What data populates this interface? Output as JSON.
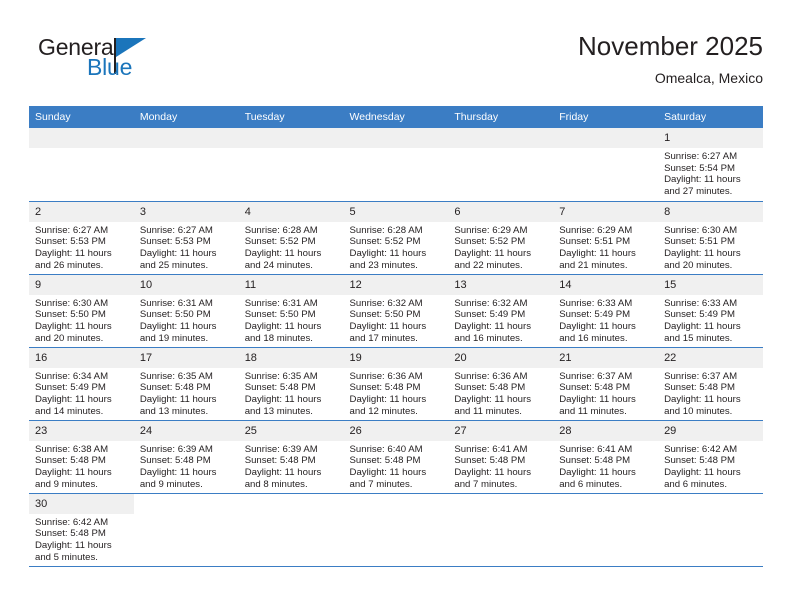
{
  "logo": {
    "name": "general-blue-logo",
    "word_one": "General",
    "word_two": "Blue",
    "brand_color": "#1b75bb"
  },
  "header": {
    "title": "November 2025",
    "subtitle": "Omealca, Mexico"
  },
  "theme": {
    "header_blue": "#3b7dc4",
    "daynum_band": "#f0f0f0",
    "text": "#231f20"
  },
  "calendar": {
    "weekday_headers": [
      "Sunday",
      "Monday",
      "Tuesday",
      "Wednesday",
      "Thursday",
      "Friday",
      "Saturday"
    ],
    "weeks": [
      [
        {
          "day": "",
          "empty": true
        },
        {
          "day": "",
          "empty": true
        },
        {
          "day": "",
          "empty": true
        },
        {
          "day": "",
          "empty": true
        },
        {
          "day": "",
          "empty": true
        },
        {
          "day": "",
          "empty": true
        },
        {
          "day": "1",
          "sunrise": "Sunrise: 6:27 AM",
          "sunset": "Sunset: 5:54 PM",
          "daylight_1": "Daylight: 11 hours",
          "daylight_2": "and 27 minutes."
        }
      ],
      [
        {
          "day": "2",
          "sunrise": "Sunrise: 6:27 AM",
          "sunset": "Sunset: 5:53 PM",
          "daylight_1": "Daylight: 11 hours",
          "daylight_2": "and 26 minutes."
        },
        {
          "day": "3",
          "sunrise": "Sunrise: 6:27 AM",
          "sunset": "Sunset: 5:53 PM",
          "daylight_1": "Daylight: 11 hours",
          "daylight_2": "and 25 minutes."
        },
        {
          "day": "4",
          "sunrise": "Sunrise: 6:28 AM",
          "sunset": "Sunset: 5:52 PM",
          "daylight_1": "Daylight: 11 hours",
          "daylight_2": "and 24 minutes."
        },
        {
          "day": "5",
          "sunrise": "Sunrise: 6:28 AM",
          "sunset": "Sunset: 5:52 PM",
          "daylight_1": "Daylight: 11 hours",
          "daylight_2": "and 23 minutes."
        },
        {
          "day": "6",
          "sunrise": "Sunrise: 6:29 AM",
          "sunset": "Sunset: 5:52 PM",
          "daylight_1": "Daylight: 11 hours",
          "daylight_2": "and 22 minutes."
        },
        {
          "day": "7",
          "sunrise": "Sunrise: 6:29 AM",
          "sunset": "Sunset: 5:51 PM",
          "daylight_1": "Daylight: 11 hours",
          "daylight_2": "and 21 minutes."
        },
        {
          "day": "8",
          "sunrise": "Sunrise: 6:30 AM",
          "sunset": "Sunset: 5:51 PM",
          "daylight_1": "Daylight: 11 hours",
          "daylight_2": "and 20 minutes."
        }
      ],
      [
        {
          "day": "9",
          "sunrise": "Sunrise: 6:30 AM",
          "sunset": "Sunset: 5:50 PM",
          "daylight_1": "Daylight: 11 hours",
          "daylight_2": "and 20 minutes."
        },
        {
          "day": "10",
          "sunrise": "Sunrise: 6:31 AM",
          "sunset": "Sunset: 5:50 PM",
          "daylight_1": "Daylight: 11 hours",
          "daylight_2": "and 19 minutes."
        },
        {
          "day": "11",
          "sunrise": "Sunrise: 6:31 AM",
          "sunset": "Sunset: 5:50 PM",
          "daylight_1": "Daylight: 11 hours",
          "daylight_2": "and 18 minutes."
        },
        {
          "day": "12",
          "sunrise": "Sunrise: 6:32 AM",
          "sunset": "Sunset: 5:50 PM",
          "daylight_1": "Daylight: 11 hours",
          "daylight_2": "and 17 minutes."
        },
        {
          "day": "13",
          "sunrise": "Sunrise: 6:32 AM",
          "sunset": "Sunset: 5:49 PM",
          "daylight_1": "Daylight: 11 hours",
          "daylight_2": "and 16 minutes."
        },
        {
          "day": "14",
          "sunrise": "Sunrise: 6:33 AM",
          "sunset": "Sunset: 5:49 PM",
          "daylight_1": "Daylight: 11 hours",
          "daylight_2": "and 16 minutes."
        },
        {
          "day": "15",
          "sunrise": "Sunrise: 6:33 AM",
          "sunset": "Sunset: 5:49 PM",
          "daylight_1": "Daylight: 11 hours",
          "daylight_2": "and 15 minutes."
        }
      ],
      [
        {
          "day": "16",
          "sunrise": "Sunrise: 6:34 AM",
          "sunset": "Sunset: 5:49 PM",
          "daylight_1": "Daylight: 11 hours",
          "daylight_2": "and 14 minutes."
        },
        {
          "day": "17",
          "sunrise": "Sunrise: 6:35 AM",
          "sunset": "Sunset: 5:48 PM",
          "daylight_1": "Daylight: 11 hours",
          "daylight_2": "and 13 minutes."
        },
        {
          "day": "18",
          "sunrise": "Sunrise: 6:35 AM",
          "sunset": "Sunset: 5:48 PM",
          "daylight_1": "Daylight: 11 hours",
          "daylight_2": "and 13 minutes."
        },
        {
          "day": "19",
          "sunrise": "Sunrise: 6:36 AM",
          "sunset": "Sunset: 5:48 PM",
          "daylight_1": "Daylight: 11 hours",
          "daylight_2": "and 12 minutes."
        },
        {
          "day": "20",
          "sunrise": "Sunrise: 6:36 AM",
          "sunset": "Sunset: 5:48 PM",
          "daylight_1": "Daylight: 11 hours",
          "daylight_2": "and 11 minutes."
        },
        {
          "day": "21",
          "sunrise": "Sunrise: 6:37 AM",
          "sunset": "Sunset: 5:48 PM",
          "daylight_1": "Daylight: 11 hours",
          "daylight_2": "and 11 minutes."
        },
        {
          "day": "22",
          "sunrise": "Sunrise: 6:37 AM",
          "sunset": "Sunset: 5:48 PM",
          "daylight_1": "Daylight: 11 hours",
          "daylight_2": "and 10 minutes."
        }
      ],
      [
        {
          "day": "23",
          "sunrise": "Sunrise: 6:38 AM",
          "sunset": "Sunset: 5:48 PM",
          "daylight_1": "Daylight: 11 hours",
          "daylight_2": "and 9 minutes."
        },
        {
          "day": "24",
          "sunrise": "Sunrise: 6:39 AM",
          "sunset": "Sunset: 5:48 PM",
          "daylight_1": "Daylight: 11 hours",
          "daylight_2": "and 9 minutes."
        },
        {
          "day": "25",
          "sunrise": "Sunrise: 6:39 AM",
          "sunset": "Sunset: 5:48 PM",
          "daylight_1": "Daylight: 11 hours",
          "daylight_2": "and 8 minutes."
        },
        {
          "day": "26",
          "sunrise": "Sunrise: 6:40 AM",
          "sunset": "Sunset: 5:48 PM",
          "daylight_1": "Daylight: 11 hours",
          "daylight_2": "and 7 minutes."
        },
        {
          "day": "27",
          "sunrise": "Sunrise: 6:41 AM",
          "sunset": "Sunset: 5:48 PM",
          "daylight_1": "Daylight: 11 hours",
          "daylight_2": "and 7 minutes."
        },
        {
          "day": "28",
          "sunrise": "Sunrise: 6:41 AM",
          "sunset": "Sunset: 5:48 PM",
          "daylight_1": "Daylight: 11 hours",
          "daylight_2": "and 6 minutes."
        },
        {
          "day": "29",
          "sunrise": "Sunrise: 6:42 AM",
          "sunset": "Sunset: 5:48 PM",
          "daylight_1": "Daylight: 11 hours",
          "daylight_2": "and 6 minutes."
        }
      ],
      [
        {
          "day": "30",
          "sunrise": "Sunrise: 6:42 AM",
          "sunset": "Sunset: 5:48 PM",
          "daylight_1": "Daylight: 11 hours",
          "daylight_2": "and 5 minutes."
        },
        {
          "day": "",
          "empty": true,
          "blank": true
        },
        {
          "day": "",
          "empty": true,
          "blank": true
        },
        {
          "day": "",
          "empty": true,
          "blank": true
        },
        {
          "day": "",
          "empty": true,
          "blank": true
        },
        {
          "day": "",
          "empty": true,
          "blank": true
        },
        {
          "day": "",
          "empty": true,
          "blank": true
        }
      ]
    ]
  }
}
